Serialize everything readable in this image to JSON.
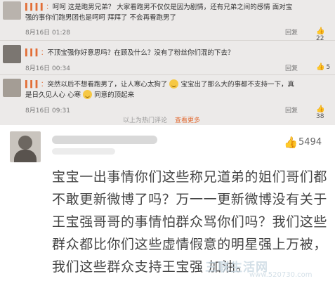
{
  "comments": [
    {
      "user": "",
      "text_line1": "呵呵 这是跑男兄弟？ 大家看跑男不仅仅是因为剧情，还有兄弟之间的感情 面对宝",
      "text_line2": "强的事你们跑男团也是呵呵 拜拜了 不会再看跑男了",
      "time": "8月16日 01:28",
      "reply": "回复",
      "likes": "22"
    },
    {
      "user": "",
      "text_line1": "不顶宝强你好意思吗？在顾及什么？没有了粉丝你们混的下去？",
      "time": "8月16日 00:34",
      "reply": "回复",
      "likes": "5"
    },
    {
      "user": "",
      "text_line1": "突然以后不想看跑男了，让人寒心太狗了",
      "text_line1b": "宝宝出了那么大的事都不支持一下，真",
      "text_line2": "是日久见人心 心寒",
      "text_line2b": "同意的顶起来",
      "time": "8月16日 09:31",
      "reply": "回复",
      "likes": "38"
    }
  ],
  "more_label": "以上为热门评论",
  "more_link": "查看更多",
  "featured": {
    "like_count": "5494",
    "text": "宝宝一出事情你们这些称兄道弟的姐们哥们都不敢更新微博了吗？万一一更新微博没有关于王宝强哥哥的事情怕群众骂你们吗？我们这些群众都比你们这些虚情假意的明星强上万被，我们这些群众支持王宝强 加油。"
  },
  "icons": {
    "like": "thumbs-up-icon",
    "emoji": "smile-emoji-icon"
  },
  "watermark": {
    "logo": "三联生活网",
    "url": "www.520730.com"
  }
}
